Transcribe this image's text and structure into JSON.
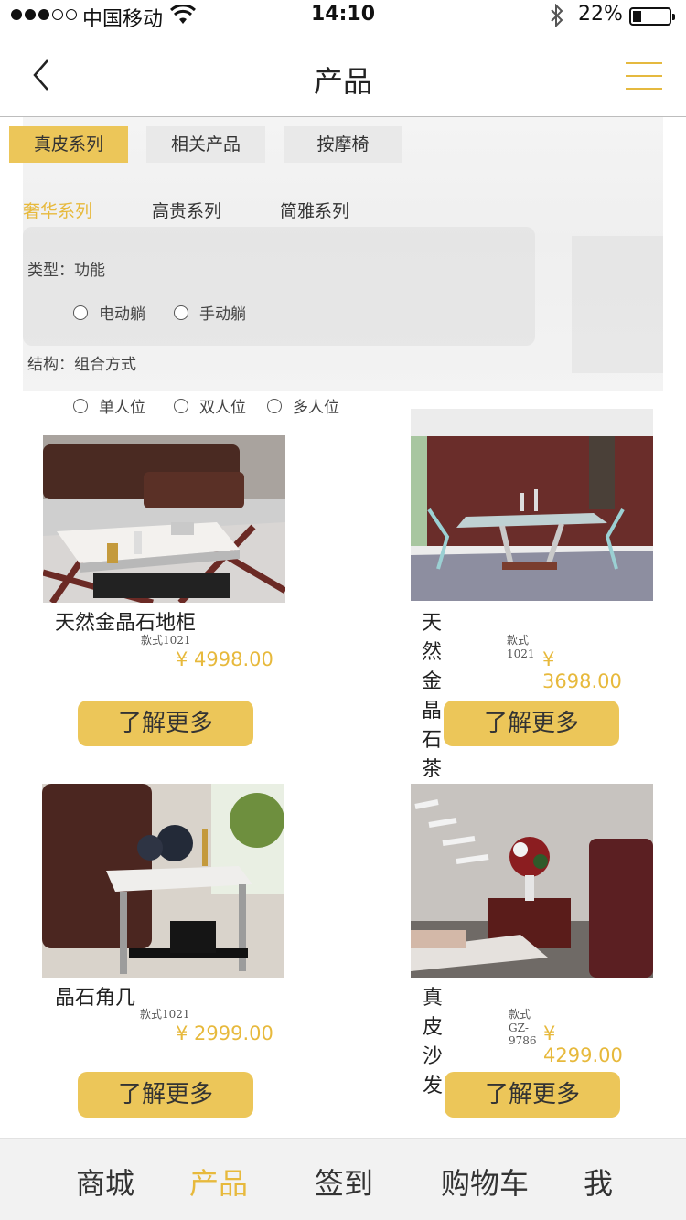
{
  "status_bar": {
    "carrier": "中国移动",
    "time": "14:10",
    "battery_percent": "22%",
    "battery_level": 0.22,
    "signal_bars_filled": 3,
    "signal_bars_total": 5
  },
  "nav": {
    "title": "产品",
    "back_icon": "chevron-left-icon",
    "menu_icon": "hamburger-menu-icon"
  },
  "category_tabs": [
    {
      "label": "真皮系列",
      "active": true
    },
    {
      "label": "相关产品",
      "active": false
    },
    {
      "label": "按摩椅",
      "active": false
    }
  ],
  "series_tabs": [
    {
      "label": "奢华系列",
      "active": true
    },
    {
      "label": "高贵系列",
      "active": false
    },
    {
      "label": "简雅系列",
      "active": false
    }
  ],
  "filters": {
    "type_label": "类型：功能",
    "type_options": [
      "电动躺",
      "手动躺"
    ],
    "structure_label": "结构：组合方式",
    "structure_options": [
      "单人位",
      "双人位",
      "多人位"
    ]
  },
  "products": [
    {
      "name": "天然金晶石地柜",
      "model": "款式1021",
      "price": "¥ 4998.00",
      "button": "了解更多"
    },
    {
      "name": "天然金晶石茶几",
      "model": "款式1021",
      "price": "¥ 3698.00",
      "button": "了解更多"
    },
    {
      "name": "晶石角几",
      "model": "款式1021",
      "price": "¥ 2999.00",
      "button": "了解更多"
    },
    {
      "name": "真皮沙发",
      "model": "款式GZ-9786",
      "price": "¥ 4299.00",
      "button": "了解更多"
    }
  ],
  "tab_bar": [
    {
      "label": "商城",
      "active": false
    },
    {
      "label": "产品",
      "active": true
    },
    {
      "label": "签到",
      "active": false
    },
    {
      "label": "购物车",
      "active": false
    },
    {
      "label": "我",
      "active": false
    }
  ],
  "colors": {
    "accent": "#e7b93c",
    "button_fill": "#ecc659",
    "tab_bar_bg": "#f2f2f2"
  }
}
